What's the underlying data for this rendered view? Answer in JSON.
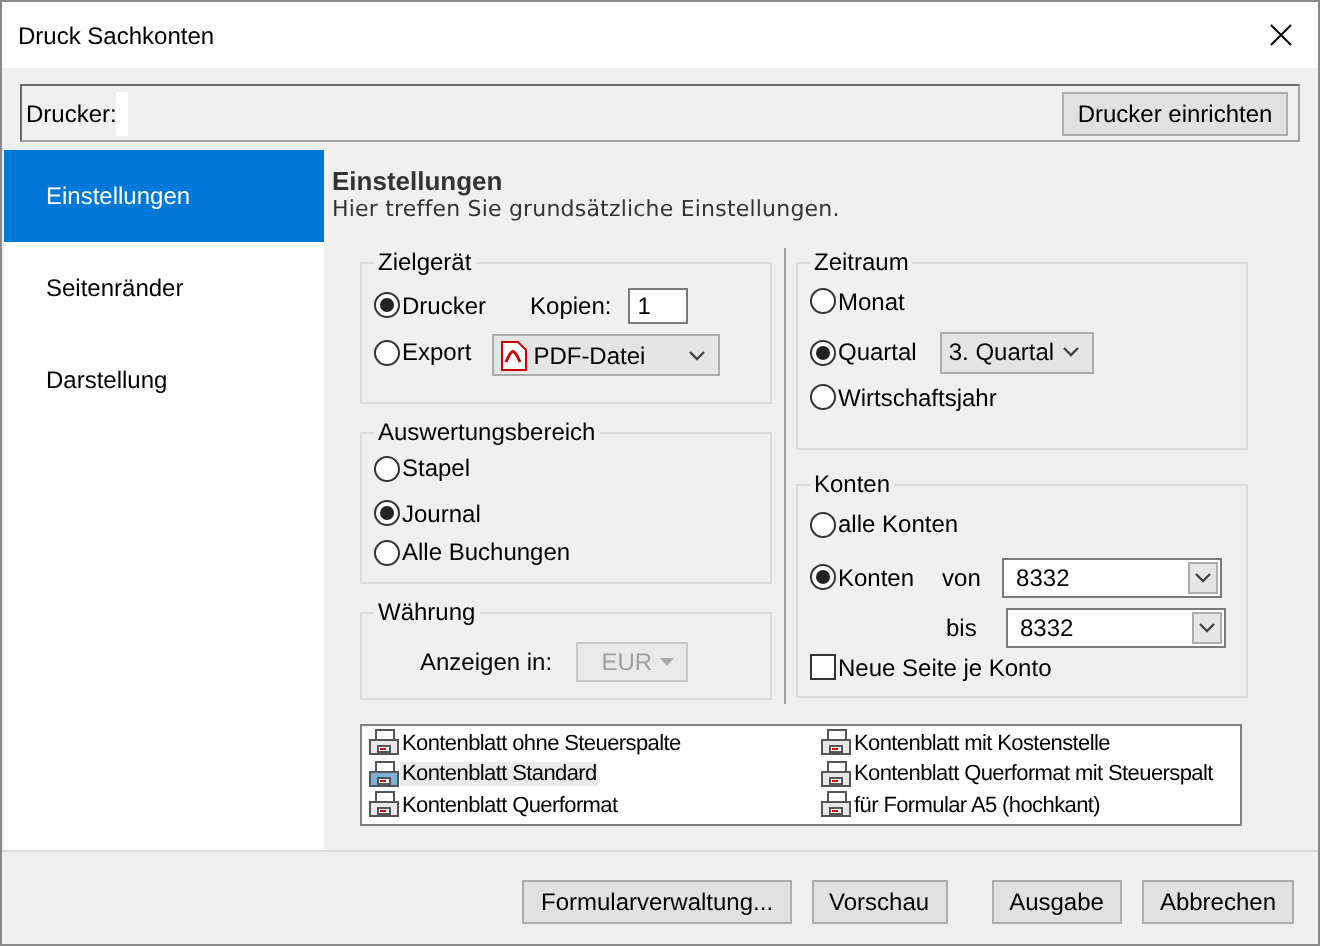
{
  "window": {
    "title": "Druck Sachkonten"
  },
  "printer": {
    "label": "Drucker:",
    "setup_button": "Drucker einrichten"
  },
  "sidebar": {
    "items": [
      {
        "label": "Einstellungen",
        "selected": true
      },
      {
        "label": "Seitenränder",
        "selected": false
      },
      {
        "label": "Darstellung",
        "selected": false
      }
    ]
  },
  "header": {
    "title": "Einstellungen",
    "subtitle": "Hier treffen Sie grundsätzliche Einstellungen."
  },
  "zielgeraet": {
    "title": "Zielgerät",
    "options": [
      {
        "label": "Drucker",
        "selected": true
      },
      {
        "label": "Export",
        "selected": false
      }
    ],
    "copies_label": "Kopien:",
    "copies": "1",
    "export_format": "PDF-Datei"
  },
  "auswertungsbereich": {
    "title": "Auswertungsbereich",
    "options": [
      {
        "label": "Stapel",
        "selected": false
      },
      {
        "label": "Journal",
        "selected": true
      },
      {
        "label": "Alle Buchungen",
        "selected": false
      }
    ]
  },
  "waehrung": {
    "title": "Währung",
    "label": "Anzeigen in:",
    "value": "EUR",
    "disabled": true
  },
  "zeitraum": {
    "title": "Zeitraum",
    "options": [
      {
        "label": "Monat",
        "selected": false
      },
      {
        "label": "Quartal",
        "selected": true
      },
      {
        "label": "Wirtschaftsjahr",
        "selected": false
      }
    ],
    "quarter": "3. Quartal"
  },
  "konten": {
    "title": "Konten",
    "options": [
      {
        "label": "alle Konten",
        "selected": false
      },
      {
        "label": "Konten",
        "selected": true
      }
    ],
    "from_label": "von",
    "from": "8332",
    "to_label": "bis",
    "to": "8332",
    "new_page": {
      "label": "Neue Seite je Konto",
      "checked": false
    }
  },
  "forms": [
    {
      "label": "Kontenblatt ohne Steuerspalte",
      "selected": false
    },
    {
      "label": "Kontenblatt mit Kostenstelle",
      "selected": false
    },
    {
      "label": "Kontenblatt Standard",
      "selected": true
    },
    {
      "label": "Kontenblatt Querformat mit Steuerspalt",
      "selected": false
    },
    {
      "label": "Kontenblatt Querformat",
      "selected": false
    },
    {
      "label": "für Formular A5 (hochkant)",
      "selected": false
    }
  ],
  "buttons": [
    {
      "label": "Formularverwaltung..."
    },
    {
      "label": "Vorschau"
    },
    {
      "label": "Ausgabe"
    },
    {
      "label": "Abbrechen"
    }
  ]
}
